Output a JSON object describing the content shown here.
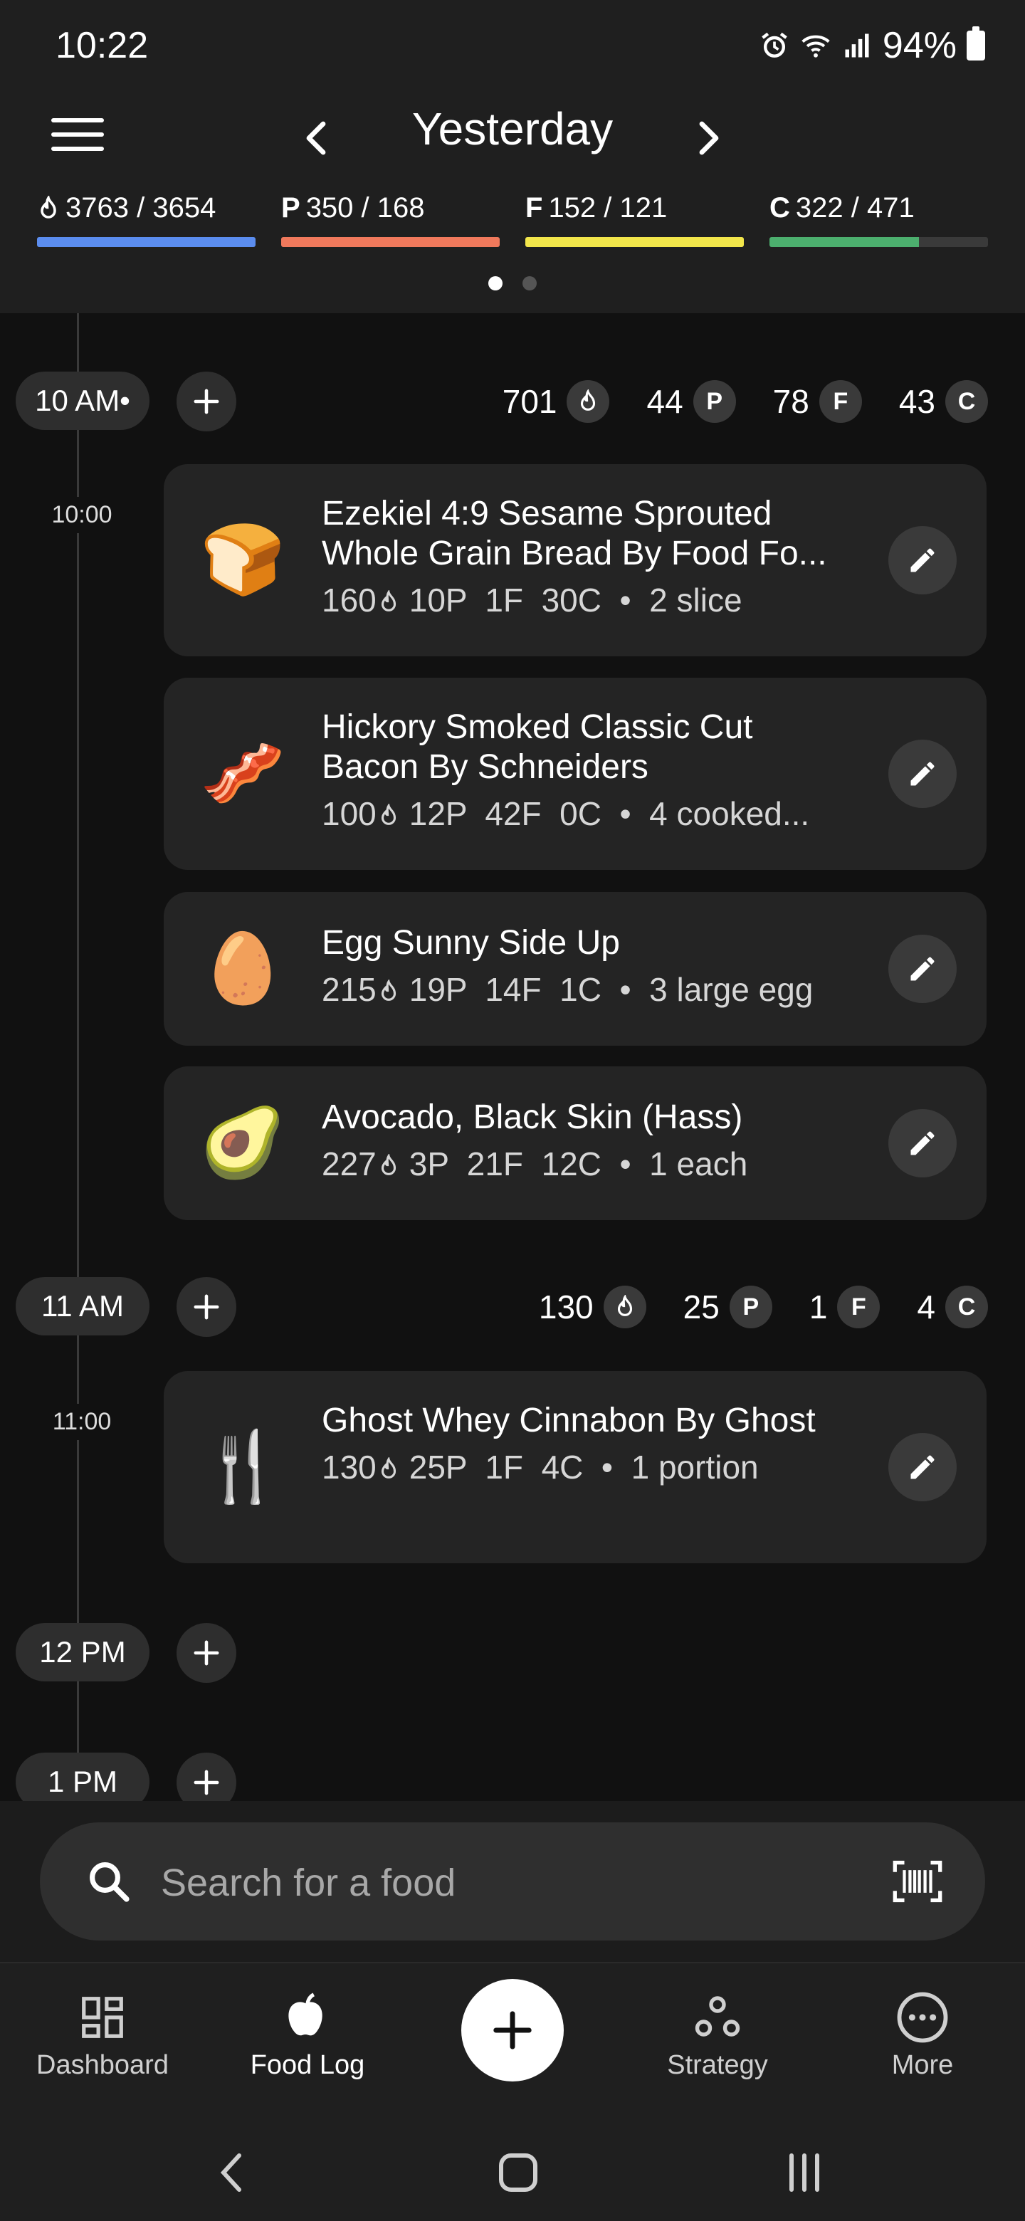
{
  "status_bar": {
    "time": "10:22",
    "battery": "94%"
  },
  "header": {
    "title": "Yesterday",
    "macros": [
      {
        "icon": "flame-icon",
        "prefix": "",
        "value": "3763 / 3654",
        "color": "#5b8def",
        "progress": 1.0
      },
      {
        "icon": "",
        "prefix": "P",
        "value": "350 / 168",
        "color": "#f0795c",
        "progress": 1.0
      },
      {
        "icon": "",
        "prefix": "F",
        "value": "152 / 121",
        "color": "#f2e64b",
        "progress": 1.0
      },
      {
        "icon": "",
        "prefix": "C",
        "value": "322 / 471",
        "color": "#4caf6e",
        "progress": 0.684
      }
    ],
    "page_count": 2,
    "active_page": 0
  },
  "hours": [
    {
      "label": "10 AM•",
      "cal": "701",
      "p": "44",
      "f": "78",
      "c": "43"
    },
    {
      "label": "11 AM",
      "cal": "130",
      "p": "25",
      "f": "1",
      "c": "4"
    },
    {
      "label": "12 PM"
    },
    {
      "label": "1 PM"
    }
  ],
  "time_labels": [
    "10:00",
    "11:00"
  ],
  "macro_badges": {
    "protein": "P",
    "fat": "F",
    "carbs": "C"
  },
  "entries": [
    {
      "emoji": "🍞",
      "name": "Ezekiel 4:9 Sesame Sprouted Whole Grain Bread By Food Fo...",
      "cal": "160",
      "macros": "10P  1F  30C  •  2 slice"
    },
    {
      "emoji": "🥓",
      "name": "Hickory Smoked Classic Cut Bacon By Schneiders",
      "cal": "100",
      "macros": "12P  42F  0C  •  4 cooked..."
    },
    {
      "emoji": "🥚",
      "name": "Egg Sunny Side Up",
      "cal": "215",
      "macros": "19P  14F  1C  •  3 large egg"
    },
    {
      "emoji": "🥑",
      "name": "Avocado, Black Skin (Hass)",
      "cal": "227",
      "macros": "3P  21F  12C  •  1 each"
    },
    {
      "emoji": "🍴",
      "name": "Ghost Whey Cinnabon By Ghost",
      "cal": "130",
      "macros": "25P  1F  4C  •  1 portion"
    }
  ],
  "search": {
    "placeholder": "Search for a food"
  },
  "bottom_nav": [
    {
      "label": "Dashboard",
      "icon": "dashboard-icon"
    },
    {
      "label": "Food Log",
      "icon": "apple-icon"
    },
    {
      "label": "Strategy",
      "icon": "strategy-icon"
    },
    {
      "label": "More",
      "icon": "more-icon"
    }
  ]
}
